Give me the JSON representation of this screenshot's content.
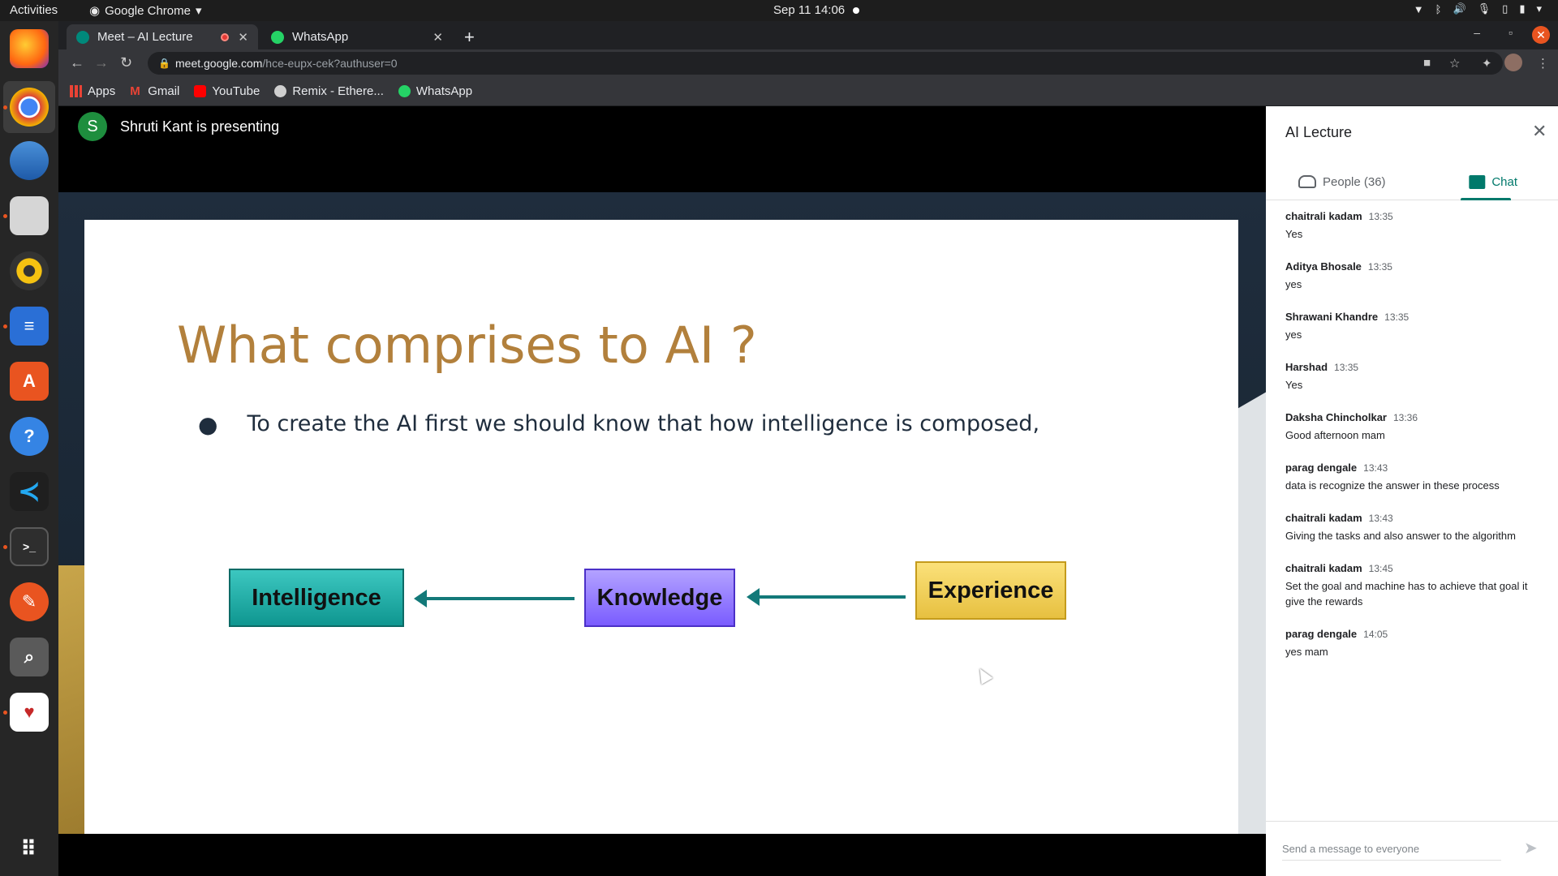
{
  "os": {
    "activities": "Activities",
    "app_name": "Google Chrome",
    "clock": "Sep 11  14:06"
  },
  "browser": {
    "tabs": [
      {
        "title": "Meet – AI Lecture"
      },
      {
        "title": "WhatsApp"
      }
    ],
    "url_host": "meet.google.com",
    "url_path": "/hce-eupx-cek?authuser=0",
    "bookmarks": [
      {
        "label": "Apps"
      },
      {
        "label": "Gmail"
      },
      {
        "label": "YouTube"
      },
      {
        "label": "Remix - Ethere..."
      },
      {
        "label": "WhatsApp"
      }
    ]
  },
  "meet": {
    "presenter_initial": "S",
    "presenter_text": "Shruti Kant is presenting",
    "slide": {
      "title": "What comprises to AI ?",
      "bullet": "To create the AI first we should know that how intelligence is composed,",
      "boxes": [
        "Intelligence",
        "Knowledge",
        "Experience"
      ]
    },
    "panel": {
      "title": "AI Lecture",
      "tab_people": "People (36)",
      "tab_chat": "Chat",
      "messages": [
        {
          "sender": "chaitrali kadam",
          "time": "13:35",
          "text": "Yes"
        },
        {
          "sender": "Aditya Bhosale",
          "time": "13:35",
          "text": "yes"
        },
        {
          "sender": "Shrawani Khandre",
          "time": "13:35",
          "text": "yes"
        },
        {
          "sender": "Harshad",
          "time": "13:35",
          "text": "Yes"
        },
        {
          "sender": "Daksha Chincholkar",
          "time": "13:36",
          "text": "Good afternoon mam"
        },
        {
          "sender": "parag dengale",
          "time": "13:43",
          "text": "data is recognize the answer in these process"
        },
        {
          "sender": "chaitrali kadam",
          "time": "13:43",
          "text": "Giving the tasks and also answer to the algorithm"
        },
        {
          "sender": "chaitrali kadam",
          "time": "13:45",
          "text": "Set the goal and machine has to achieve that goal it give the rewards"
        },
        {
          "sender": "parag dengale",
          "time": "14:05",
          "text": "yes mam"
        }
      ],
      "composer_placeholder": "Send a message to everyone"
    }
  }
}
